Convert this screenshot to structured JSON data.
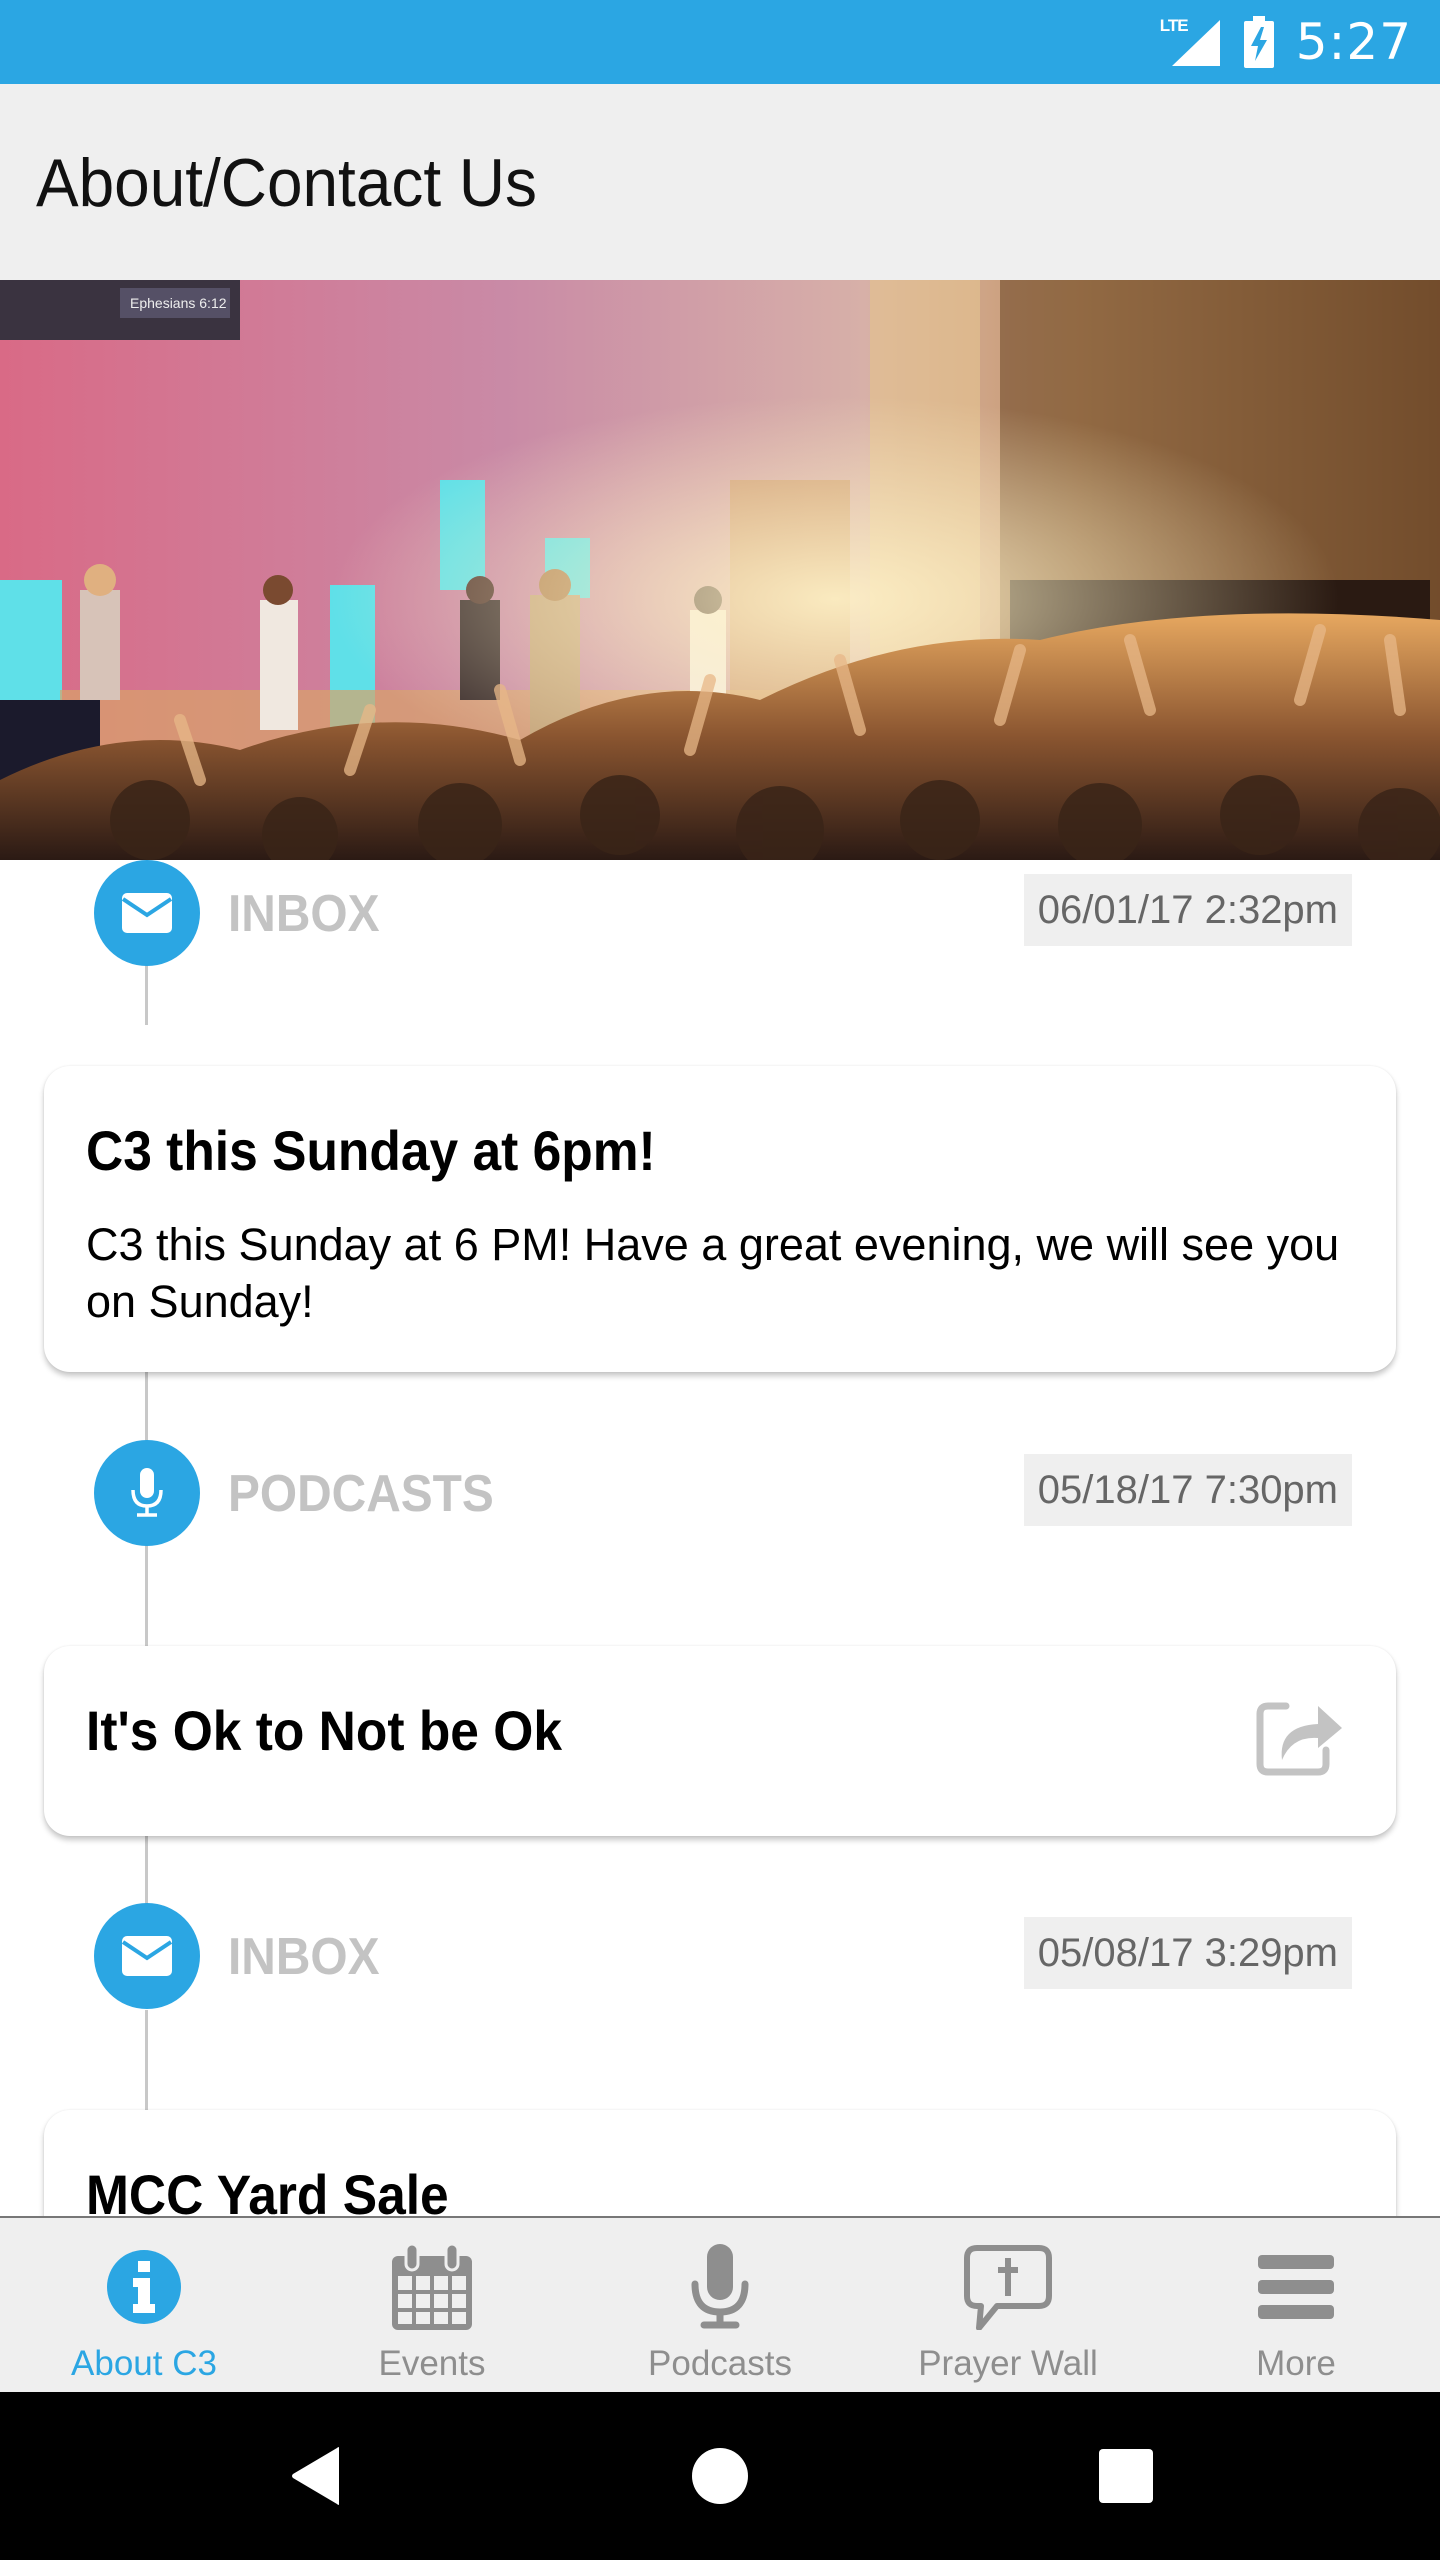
{
  "status_bar": {
    "network": "LTE",
    "time": "5:27",
    "color": "#2ba6e3"
  },
  "app_bar": {
    "title": "About/Contact Us"
  },
  "hero": {
    "alt": "Worship service photo with band on stage and congregation raising hands",
    "screen_text": "Ephesians 6:12"
  },
  "feed": [
    {
      "type": "INBOX",
      "icon": "envelope-icon",
      "date": "06/01/17 2:32pm",
      "title": "C3 this Sunday at 6pm!",
      "body": "C3 this Sunday at 6 PM!  Have a great evening, we will see you on Sunday!"
    },
    {
      "type": "PODCASTS",
      "icon": "microphone-icon",
      "date": "05/18/17 7:30pm",
      "title": "It's Ok to Not be Ok",
      "action_icon": "share-icon"
    },
    {
      "type": "INBOX",
      "icon": "envelope-icon",
      "date": "05/08/17 3:29pm",
      "title": "MCC Yard Sale"
    }
  ],
  "bottom_nav": {
    "items": [
      {
        "label": "About C3",
        "icon": "info-icon",
        "active": true
      },
      {
        "label": "Events",
        "icon": "calendar-icon",
        "active": false
      },
      {
        "label": "Podcasts",
        "icon": "microphone-icon",
        "active": false
      },
      {
        "label": "Prayer Wall",
        "icon": "prayer-bubble-icon",
        "active": false
      },
      {
        "label": "More",
        "icon": "hamburger-menu-icon",
        "active": false
      }
    ],
    "active_color": "#2ba6e3",
    "inactive_color": "#8e8e8e"
  },
  "system_nav": {
    "back": "back-icon",
    "home": "home-icon",
    "recents": "recents-icon"
  }
}
